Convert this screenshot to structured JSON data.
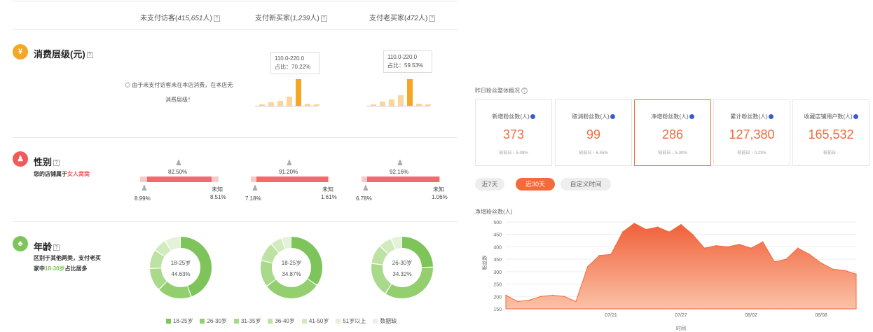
{
  "left": {
    "headers": [
      {
        "label": "未支付访客(",
        "value": "415,651",
        "unit": "人)"
      },
      {
        "label": "支付新买家(",
        "value": "1,239",
        "unit": "人)"
      },
      {
        "label": "支付老买家(",
        "value": "472",
        "unit": "人)"
      }
    ],
    "consumption": {
      "title": "消费层级(元)",
      "icon": "¥",
      "note1": "◎ 由于未支付访客未在本店消费，在本店无",
      "note2": "消费层级！",
      "tips": [
        {
          "range": "110.0-220.0",
          "ratio": "占比：70.22%"
        },
        {
          "range": "110.0-220.0",
          "ratio": "占比：59.53%"
        }
      ],
      "bars_new": [
        0.05,
        0.12,
        0.18,
        0.35,
        1.0,
        0.08,
        0.04
      ],
      "bars_old": [
        0.05,
        0.15,
        0.25,
        0.4,
        1.0,
        0.08,
        0.04
      ]
    },
    "gender": {
      "title": "性别",
      "subtitle_pre": "您的店铺属于",
      "subtitle_hl": "女人窝窝",
      "groups": [
        {
          "female": "82.50%",
          "male": "8.99%",
          "unknown_label": "未知",
          "unknown": "8.51%",
          "female_frac": 0.825,
          "male_frac": 0.0899
        },
        {
          "female": "91.20%",
          "male": "7.18%",
          "unknown_label": "未知",
          "unknown": "1.61%",
          "female_frac": 0.912,
          "male_frac": 0.0718
        },
        {
          "female": "92.16%",
          "male": "6.78%",
          "unknown_label": "未知",
          "unknown": "1.06%",
          "female_frac": 0.9216,
          "male_frac": 0.0678
        }
      ]
    },
    "age": {
      "title": "年龄",
      "line1": "区别于其他两类，支付老买",
      "line2_pre": "家中",
      "line2_hl": "18-30岁",
      "line2_post": "占比居多",
      "donuts": [
        {
          "label": "18-25岁",
          "pct": "44.63%",
          "values": [
            44.63,
            18,
            12,
            10,
            7,
            8.37
          ]
        },
        {
          "label": "18-25岁",
          "pct": "34.87%",
          "values": [
            34.87,
            30,
            14,
            10,
            6,
            5.13
          ]
        },
        {
          "label": "26-30岁",
          "pct": "34.32%",
          "values": [
            25,
            34.32,
            18,
            10,
            7,
            5.68
          ]
        }
      ],
      "legend": [
        "18-25岁",
        "26-30岁",
        "31-35岁",
        "36-40岁",
        "41-50岁",
        "51岁以上",
        "数据缺"
      ],
      "colors": [
        "#7dc45a",
        "#94cf6f",
        "#a9d98a",
        "#bde2a4",
        "#d1ebbf",
        "#e3f2d8",
        "#eeeeee"
      ]
    }
  },
  "right": {
    "section_title": "昨日粉丝整体概况",
    "cards": [
      {
        "label": "新增粉丝数(人)",
        "value": "373",
        "cmp": "较前日 ↓ 5.09%"
      },
      {
        "label": "取消粉丝数(人)",
        "value": "99",
        "cmp": "较前日 ↑ 6.45%"
      },
      {
        "label": "净增粉丝数(人)",
        "value": "286",
        "cmp": "较前日 ↓ 5.30%"
      },
      {
        "label": "累计粉丝数(人)",
        "value": "127,380",
        "cmp": "较前日 ↑ 0.23%"
      },
      {
        "label": "收藏店铺用户数(人)",
        "value": "165,532",
        "cmp": "较前日 -"
      }
    ],
    "tabs": [
      "近7天",
      "近30天",
      "自定义时间"
    ],
    "active_tab": 1,
    "accent": "#f36b3b"
  },
  "chart_data": {
    "type": "area",
    "title": "净增粉丝数(人)",
    "ylabel": "粉丝数",
    "xlabel": "时间",
    "ylim": [
      150,
      500
    ],
    "yticks": [
      150,
      200,
      250,
      300,
      350,
      400,
      450,
      500
    ],
    "xtick_labels": [
      {
        "i": 9,
        "label": "07/21"
      },
      {
        "i": 15,
        "label": "07/27"
      },
      {
        "i": 21,
        "label": "08/02"
      },
      {
        "i": 27,
        "label": "08/08"
      }
    ],
    "values": [
      205,
      180,
      185,
      200,
      205,
      200,
      180,
      320,
      365,
      370,
      460,
      495,
      470,
      480,
      460,
      490,
      450,
      395,
      405,
      400,
      410,
      395,
      420,
      340,
      350,
      395,
      370,
      335,
      310,
      305,
      290
    ],
    "color": "#f36b3b"
  }
}
